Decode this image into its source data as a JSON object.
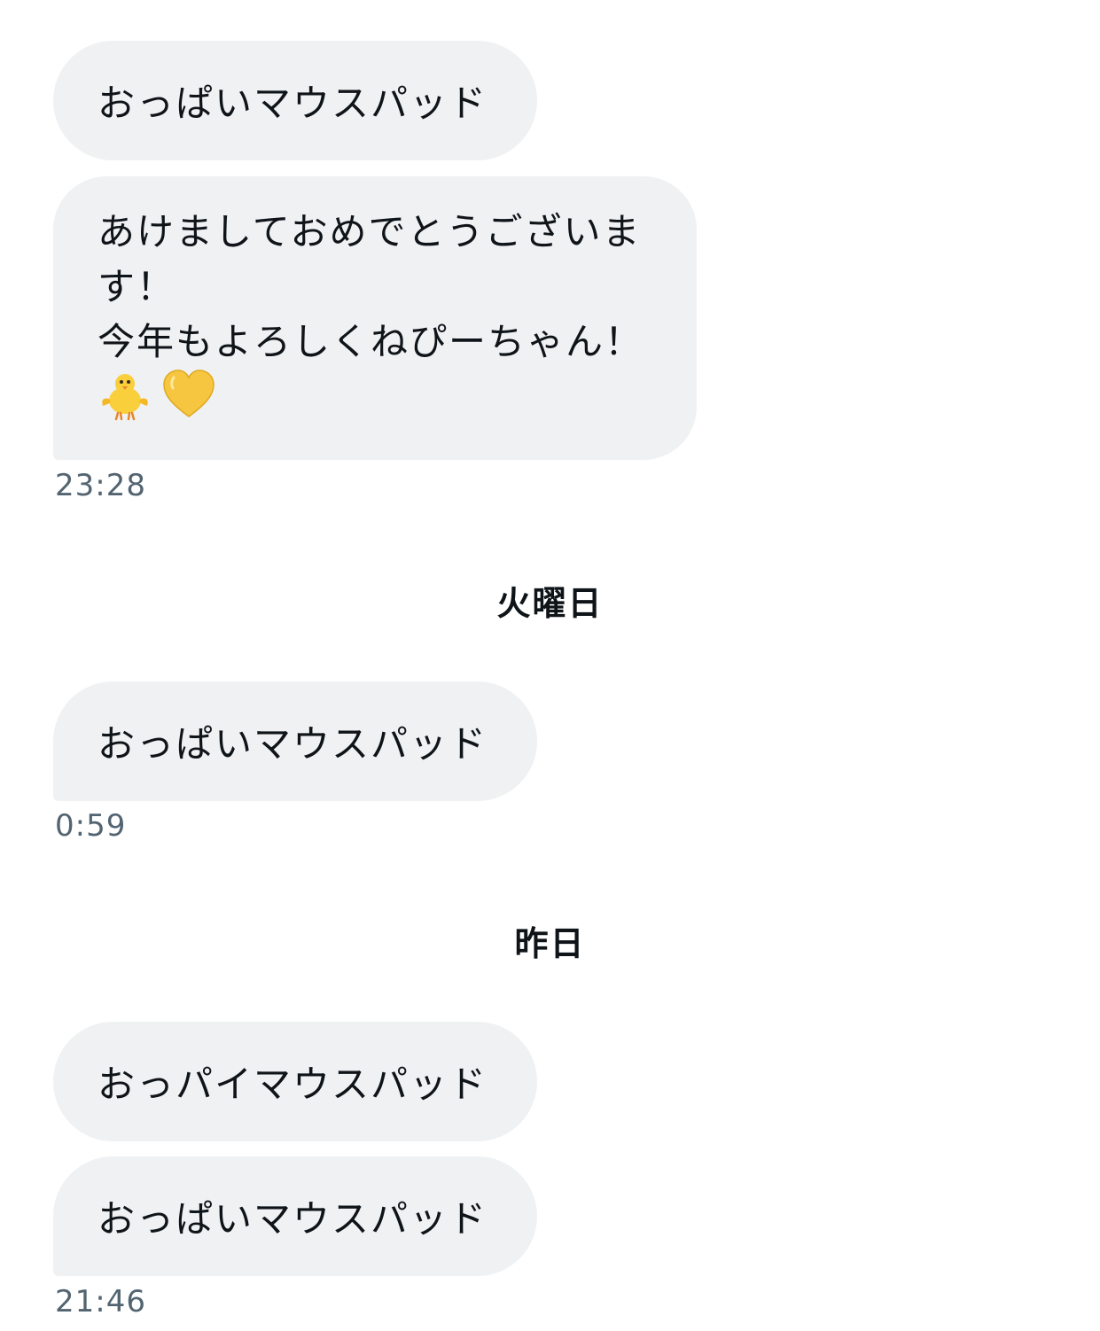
{
  "messages": [
    {
      "text": "おっぱいマウスパッド"
    },
    {
      "lines": [
        "あけましておめでとうございま",
        "す！",
        "今年もよろしくねぴーちゃん！"
      ],
      "emojis": [
        "chick-emoji",
        "yellow-heart-emoji"
      ],
      "time": "23:28"
    },
    {
      "text": "おっぱいマウスパッド",
      "time": "0:59"
    },
    {
      "text": "おっパイマウスパッド"
    },
    {
      "text": "おっぱいマウスパッド",
      "time": "21:46"
    }
  ],
  "separators": [
    "火曜日",
    "昨日"
  ],
  "colors": {
    "bubble_bg": "#eff1f3",
    "text": "#0f1419",
    "timestamp": "#536471",
    "heart": "#f7c640",
    "chick": "#f9cf3c"
  }
}
